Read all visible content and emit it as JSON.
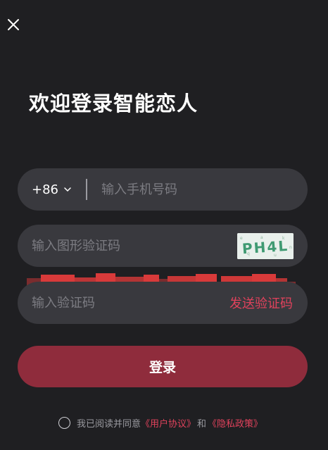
{
  "title": "欢迎登录智能恋人",
  "phone": {
    "country_code": "+86",
    "placeholder": "输入手机号码"
  },
  "image_captcha": {
    "placeholder": "输入图形验证码",
    "captcha_text": "PH4L"
  },
  "sms_code": {
    "placeholder": "输入验证码",
    "send_label": "发送验证码"
  },
  "login_label": "登录",
  "agreement": {
    "prefix": "我已阅读并同意",
    "user_agreement": "《用户协议》",
    "and": "和",
    "privacy_policy": "《隐私政策》"
  },
  "colors": {
    "background": "#1f1f22",
    "field": "#39393e",
    "accent": "#e0425c",
    "button": "#8f2c3c"
  }
}
